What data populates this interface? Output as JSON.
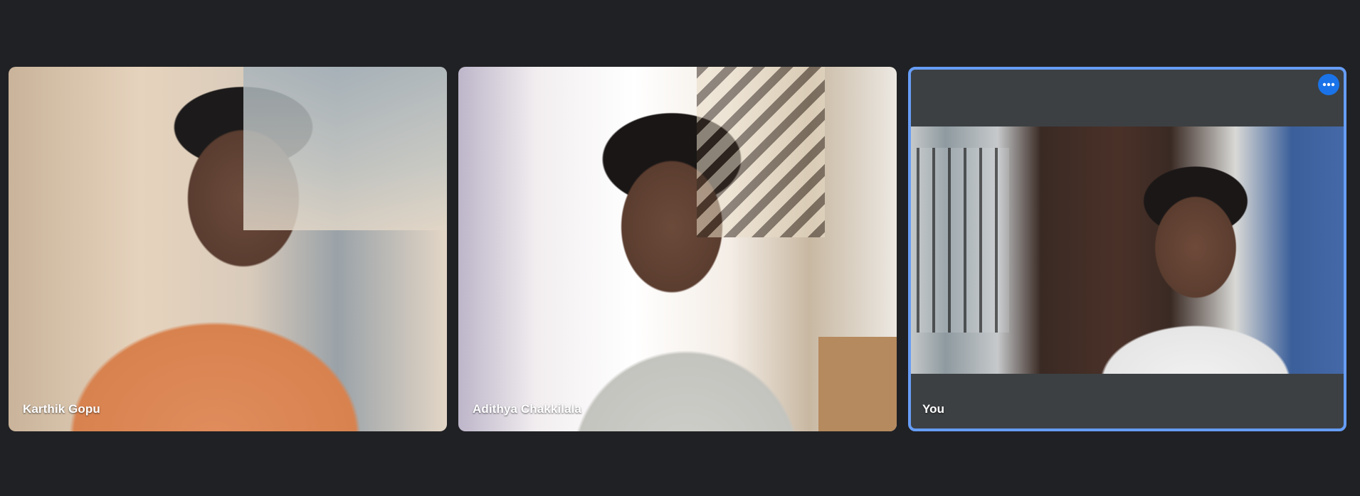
{
  "meeting": {
    "participants": [
      {
        "name": "Karthik Gopu",
        "active_speaker": false
      },
      {
        "name": "Adithya Chakkilala",
        "active_speaker": false
      },
      {
        "name": "You",
        "active_speaker": true
      }
    ],
    "self_tile": {
      "more_options_icon": "more-horiz-icon"
    }
  },
  "colors": {
    "background": "#202124",
    "self_tile_border": "#669df6",
    "more_button": "#1a73e8",
    "self_tile_letterbox": "#3c4043"
  }
}
